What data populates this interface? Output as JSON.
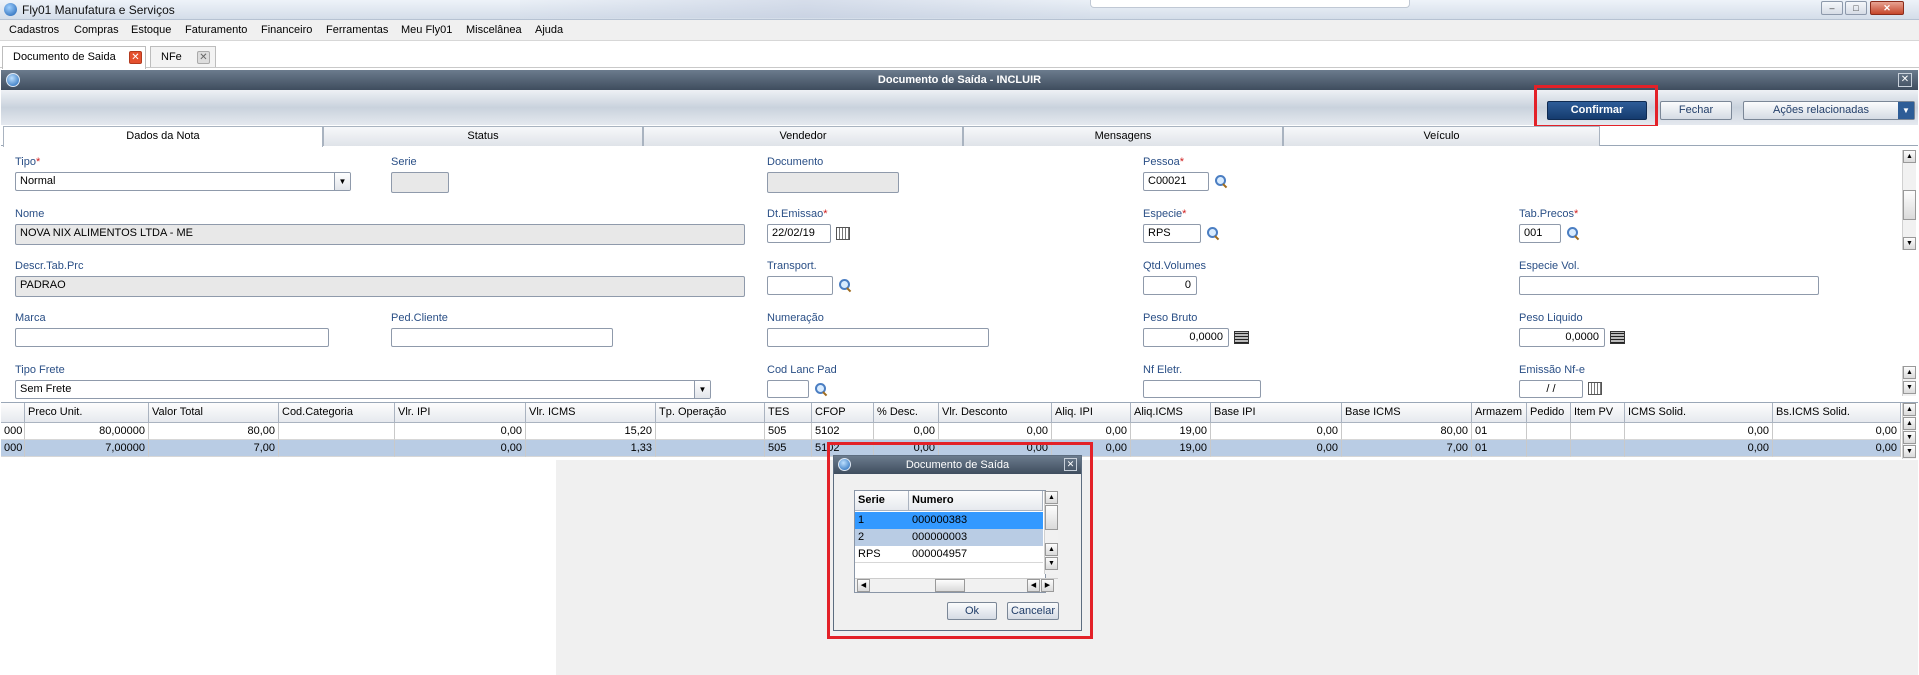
{
  "app": {
    "title": "Fly01 Manufatura e Serviços"
  },
  "menu": [
    "Cadastros",
    "Compras",
    "Estoque",
    "Faturamento",
    "Financeiro",
    "Ferramentas",
    "Meu Fly01",
    "Miscelânea",
    "Ajuda"
  ],
  "doc_tabs": [
    {
      "label": "Documento de Saida",
      "active": true
    },
    {
      "label": "NFe",
      "active": false
    }
  ],
  "window": {
    "title": "Documento de Saída - INCLUIR",
    "toolbar": {
      "confirm": "Confirmar",
      "close": "Fechar",
      "actions": "Ações relacionadas"
    }
  },
  "section_tabs": [
    "Dados da Nota",
    "Status",
    "Vendedor",
    "Mensagens",
    "Veículo"
  ],
  "form": {
    "tipo": {
      "label": "Tipo",
      "value": "Normal"
    },
    "serie": {
      "label": "Serie",
      "value": ""
    },
    "documento": {
      "label": "Documento",
      "value": ""
    },
    "pessoa": {
      "label": "Pessoa",
      "value": "C00021"
    },
    "nome": {
      "label": "Nome",
      "value": "NOVA NIX ALIMENTOS LTDA - ME"
    },
    "dt_emissao": {
      "label": "Dt.Emissao",
      "value": "22/02/19"
    },
    "especie": {
      "label": "Especie",
      "value": "RPS"
    },
    "tab_precos": {
      "label": "Tab.Precos",
      "value": "001"
    },
    "descr_tab_prc": {
      "label": "Descr.Tab.Prc",
      "value": "PADRAO"
    },
    "transport": {
      "label": "Transport.",
      "value": ""
    },
    "qtd_volumes": {
      "label": "Qtd.Volumes",
      "value": "0"
    },
    "especie_vol": {
      "label": "Especie Vol.",
      "value": ""
    },
    "marca": {
      "label": "Marca",
      "value": ""
    },
    "ped_cliente": {
      "label": "Ped.Cliente",
      "value": ""
    },
    "numeracao": {
      "label": "Numeração",
      "value": ""
    },
    "peso_bruto": {
      "label": "Peso Bruto",
      "value": "0,0000"
    },
    "peso_liquido": {
      "label": "Peso Liquido",
      "value": "0,0000"
    },
    "tipo_frete": {
      "label": "Tipo Frete",
      "value": "Sem Frete"
    },
    "cod_lanc_pad": {
      "label": "Cod Lanc Pad",
      "value": ""
    },
    "nf_eletr": {
      "label": "Nf Eletr.",
      "value": ""
    },
    "emissao_nfe": {
      "label": "Emissão Nf-e",
      "value": "/ /"
    }
  },
  "grid": {
    "columns": [
      "Preco Unit.",
      "Valor Total",
      "Cod.Categoria",
      "Vlr. IPI",
      "Vlr. ICMS",
      "Tp. Operação",
      "TES",
      "CFOP",
      "% Desc.",
      "Vlr. Desconto",
      "Aliq. IPI",
      "Aliq.ICMS",
      "Base IPI",
      "Base ICMS",
      "Armazem",
      "Pedido",
      "Item PV",
      "ICMS Solid.",
      "Bs.ICMS Solid."
    ],
    "rows": [
      {
        "lead": "000",
        "cells": [
          "80,00000",
          "80,00",
          "",
          "0,00",
          "15,20",
          "",
          "505",
          "5102",
          "0,00",
          "0,00",
          "0,00",
          "19,00",
          "0,00",
          "80,00",
          "01",
          "",
          "",
          "0,00",
          "0,00"
        ]
      },
      {
        "lead": "000",
        "cells": [
          "7,00000",
          "7,00",
          "",
          "0,00",
          "1,33",
          "",
          "505",
          "5102",
          "0,00",
          "0,00",
          "0,00",
          "19,00",
          "0,00",
          "7,00",
          "01",
          "",
          "",
          "0,00",
          "0,00"
        ]
      }
    ]
  },
  "popup": {
    "title": "Documento de Saída",
    "columns": [
      "Serie",
      "Numero"
    ],
    "rows": [
      {
        "serie": "1",
        "numero": "000000383"
      },
      {
        "serie": "2",
        "numero": "000000003"
      },
      {
        "serie": "RPS",
        "numero": "000004957"
      }
    ],
    "ok": "Ok",
    "cancel": "Cancelar"
  }
}
